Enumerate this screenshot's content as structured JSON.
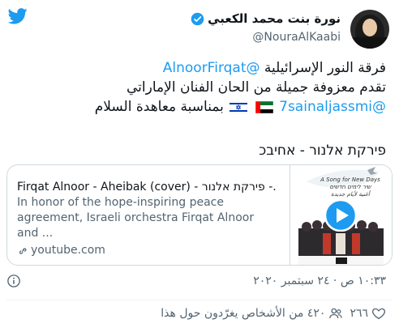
{
  "header": {
    "display_name": "نورة بنت محمد الكعبي",
    "handle": "@NouraAlKaabi",
    "logo_icon": "twitter-bird-icon",
    "verified_icon": "verified-badge-icon"
  },
  "tweet": {
    "line1_text": "فرقة النور الإسرائيلية",
    "line1_mention": "@AlnoorFirqat",
    "line2_text": "تقدم معزوفة جميلة من الحان الفنان الإماراتي",
    "line3_mention": "@7sainaljassmi",
    "line3_text": "بمناسبة معاهدة السلام",
    "hebrew_line": "פירקת אלנור - אחיבכ"
  },
  "card": {
    "title": "Firqat Alnoor - Aheibak (cover) - פירקת אלנור -...",
    "description": "In honor of the hope-inspiring peace agreement, Israeli orchestra Firqat Alnoor and ...",
    "domain": "youtube.com",
    "thumbnail_caption_en": "A Song for New Days",
    "thumbnail_caption_he1": "שיר לימים חדשים",
    "thumbnail_caption_he2": "أغنية لأيام جديدة"
  },
  "timestamp": "١٠:٣٣ ص · ٢٤ سبتمبر ٢٠٢٠",
  "actions": {
    "likes_count": "٢٦٦",
    "people_talking": "٤٢٠ من الأشخاص يغرّدون حول هذا"
  },
  "colors": {
    "accent": "#1d9bf0",
    "secondary_text": "#536471",
    "border": "#cfd9de"
  }
}
